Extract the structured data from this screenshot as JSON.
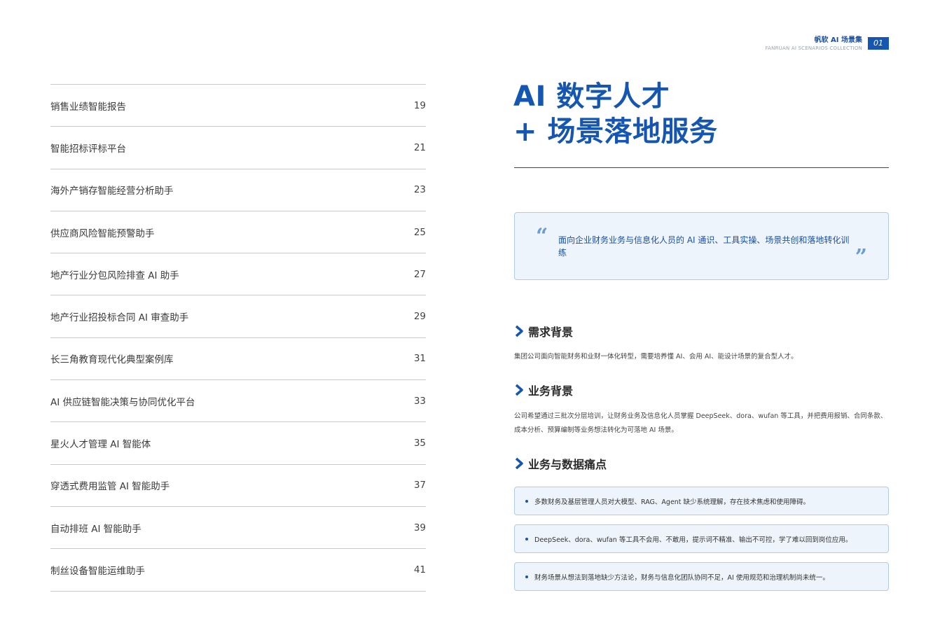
{
  "header": {
    "brand_title": "帆软 AI 场景集",
    "brand_subtitle": "FANRUAN AI SCENARIOS COLLECTION",
    "page_number": "01"
  },
  "toc": [
    {
      "title": "销售业绩智能报告",
      "page": "19"
    },
    {
      "title": "智能招标评标平台",
      "page": "21"
    },
    {
      "title": "海外产销存智能经营分析助手",
      "page": "23"
    },
    {
      "title": "供应商风险智能预警助手",
      "page": "25"
    },
    {
      "title": "地产行业分包风险排查 AI 助手",
      "page": "27"
    },
    {
      "title": "地产行业招投标合同 AI 审查助手",
      "page": "29"
    },
    {
      "title": "长三角教育现代化典型案例库",
      "page": "31"
    },
    {
      "title": "AI 供应链智能决策与协同优化平台",
      "page": "33"
    },
    {
      "title": "星火人才管理 AI 智能体",
      "page": "35"
    },
    {
      "title": "穿透式费用监管 AI 智能助手",
      "page": "37"
    },
    {
      "title": "自动排班 AI 智能助手",
      "page": "39"
    },
    {
      "title": "制丝设备智能运维助手",
      "page": "41"
    }
  ],
  "hero": {
    "line1": "AI 数字人才",
    "line2": "+ 场景落地服务"
  },
  "quote": {
    "open_mark": "“",
    "close_mark": "”",
    "text": "面向企业财务业务与信息化人员的 AI 通识、工具实操、场景共创和落地转化训练"
  },
  "sections": {
    "demand_title": "需求背景",
    "demand_text": "集团公司面向智能财务和业财一体化转型，需要培养懂 AI、会用 AI、能设计场景的复合型人才。",
    "business_title": "业务背景",
    "business_text": "公司希望通过三批次分层培训，让财务业务及信息化人员掌握 DeepSeek、dora、wufan 等工具，并把费用报销、合同条款、成本分析、预算编制等业务想法转化为可落地 AI 场景。",
    "pain_title": "业务与数据痛点",
    "pain_points": [
      "多数财务及基层管理人员对大模型、RAG、Agent 缺少系统理解，存在技术焦虑和使用障碍。",
      "DeepSeek、dora、wufan 等工具不会用、不敢用，提示词不精准、输出不可控，学了难以回到岗位应用。",
      "财务场景从想法到落地缺少方法论，财务与信息化团队协同不足，AI 使用规范和治理机制尚未统一。"
    ]
  },
  "colors": {
    "accent": "#1557b0",
    "box_bg": "#edf4fc",
    "box_border": "#aecbea"
  }
}
